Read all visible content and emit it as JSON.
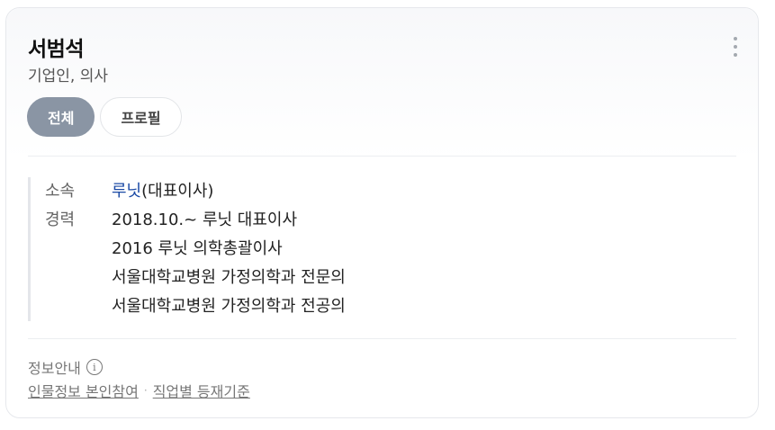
{
  "profile": {
    "name": "서범석",
    "occupation": "기업인, 의사"
  },
  "tabs": [
    {
      "label": "전체",
      "active": true
    },
    {
      "label": "프로필",
      "active": false
    }
  ],
  "details": {
    "affiliation_label": "소속",
    "affiliation_link": "루닛",
    "affiliation_suffix": "(대표이사)",
    "career_label": "경력",
    "career": [
      "2018.10.~ 루닛 대표이사",
      "2016 루닛 의학총괄이사",
      "서울대학교병원 가정의학과 전문의",
      "서울대학교병원 가정의학과 전공의"
    ]
  },
  "footer": {
    "title": "정보안내",
    "info_icon": "i",
    "links": [
      "인물정보 본인참여",
      "직업별 등재기준"
    ],
    "separator": "·"
  },
  "colors": {
    "active_tab": "#8a95a4",
    "link_blue": "#1b4aa5"
  }
}
